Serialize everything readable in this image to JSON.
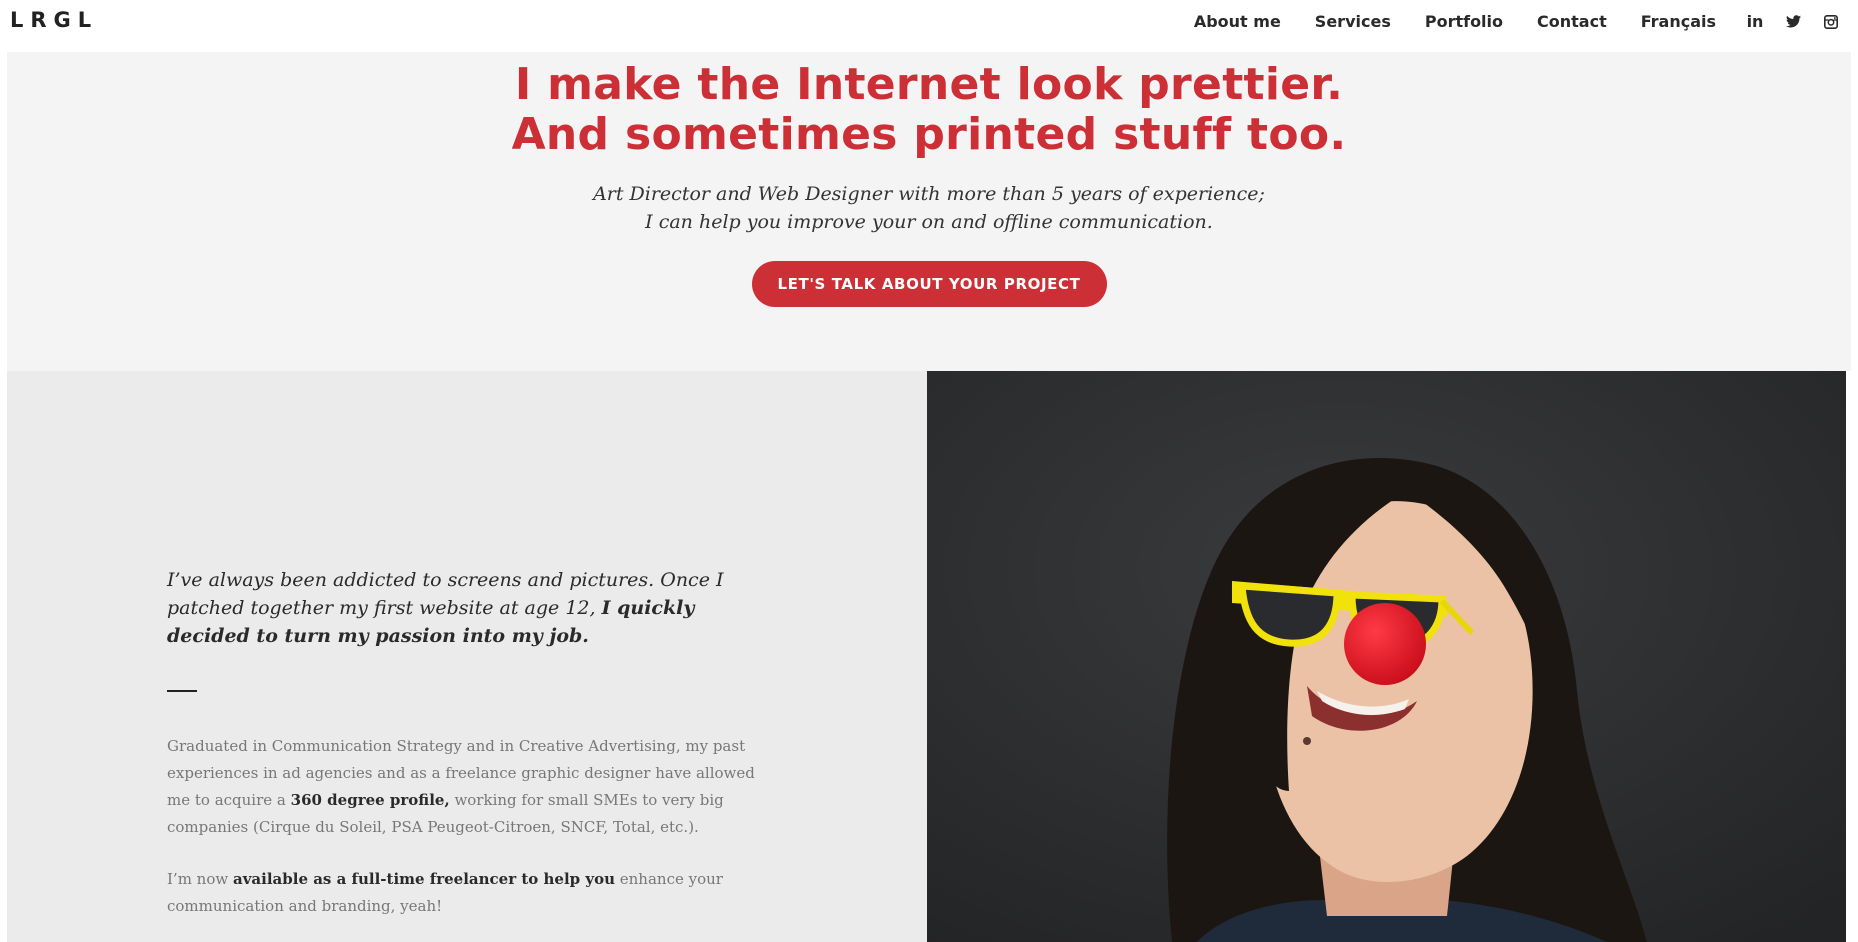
{
  "header": {
    "logo": "LRGL",
    "nav": [
      "About me",
      "Services",
      "Portfolio",
      "Contact",
      "Français"
    ],
    "social": [
      "linkedin-icon",
      "twitter-icon",
      "instagram-icon"
    ],
    "linkedin_glyph": "in"
  },
  "hero": {
    "title_line1": "I make the Internet look prettier.",
    "title_line2": "And sometimes printed stuff too.",
    "sub_line1": "Art Director and Web Designer with more than 5 years of experience;",
    "sub_line2": "I can help you improve your on and offline communication.",
    "cta": "LET'S TALK ABOUT YOUR PROJECT"
  },
  "about": {
    "intro_plain": "I’ve always been addicted to screens and pictures. Once I patched together my first website at age 12, ",
    "intro_bold": "I quickly decided to turn my passion into my job.",
    "p1_a": "Graduated in Communication Strategy and in Creative Advertising, my past experiences in ad agencies and as a freelance graphic designer have allowed me to acquire a ",
    "p1_bold": "360 degree profile,",
    "p1_b": " working for small SMEs to very big companies (Cirque du Soleil, PSA Peugeot-Citroen, SNCF, Total, etc.).",
    "p2_a": "I’m now ",
    "p2_bold": "available as a full-time freelancer to help you",
    "p2_b": " enhance your communication and branding, yeah!"
  },
  "colors": {
    "accent": "#cc2f36",
    "hero_bg": "#f4f4f4",
    "about_bg": "#ebebeb",
    "photo_bg": "#2e2f31"
  }
}
